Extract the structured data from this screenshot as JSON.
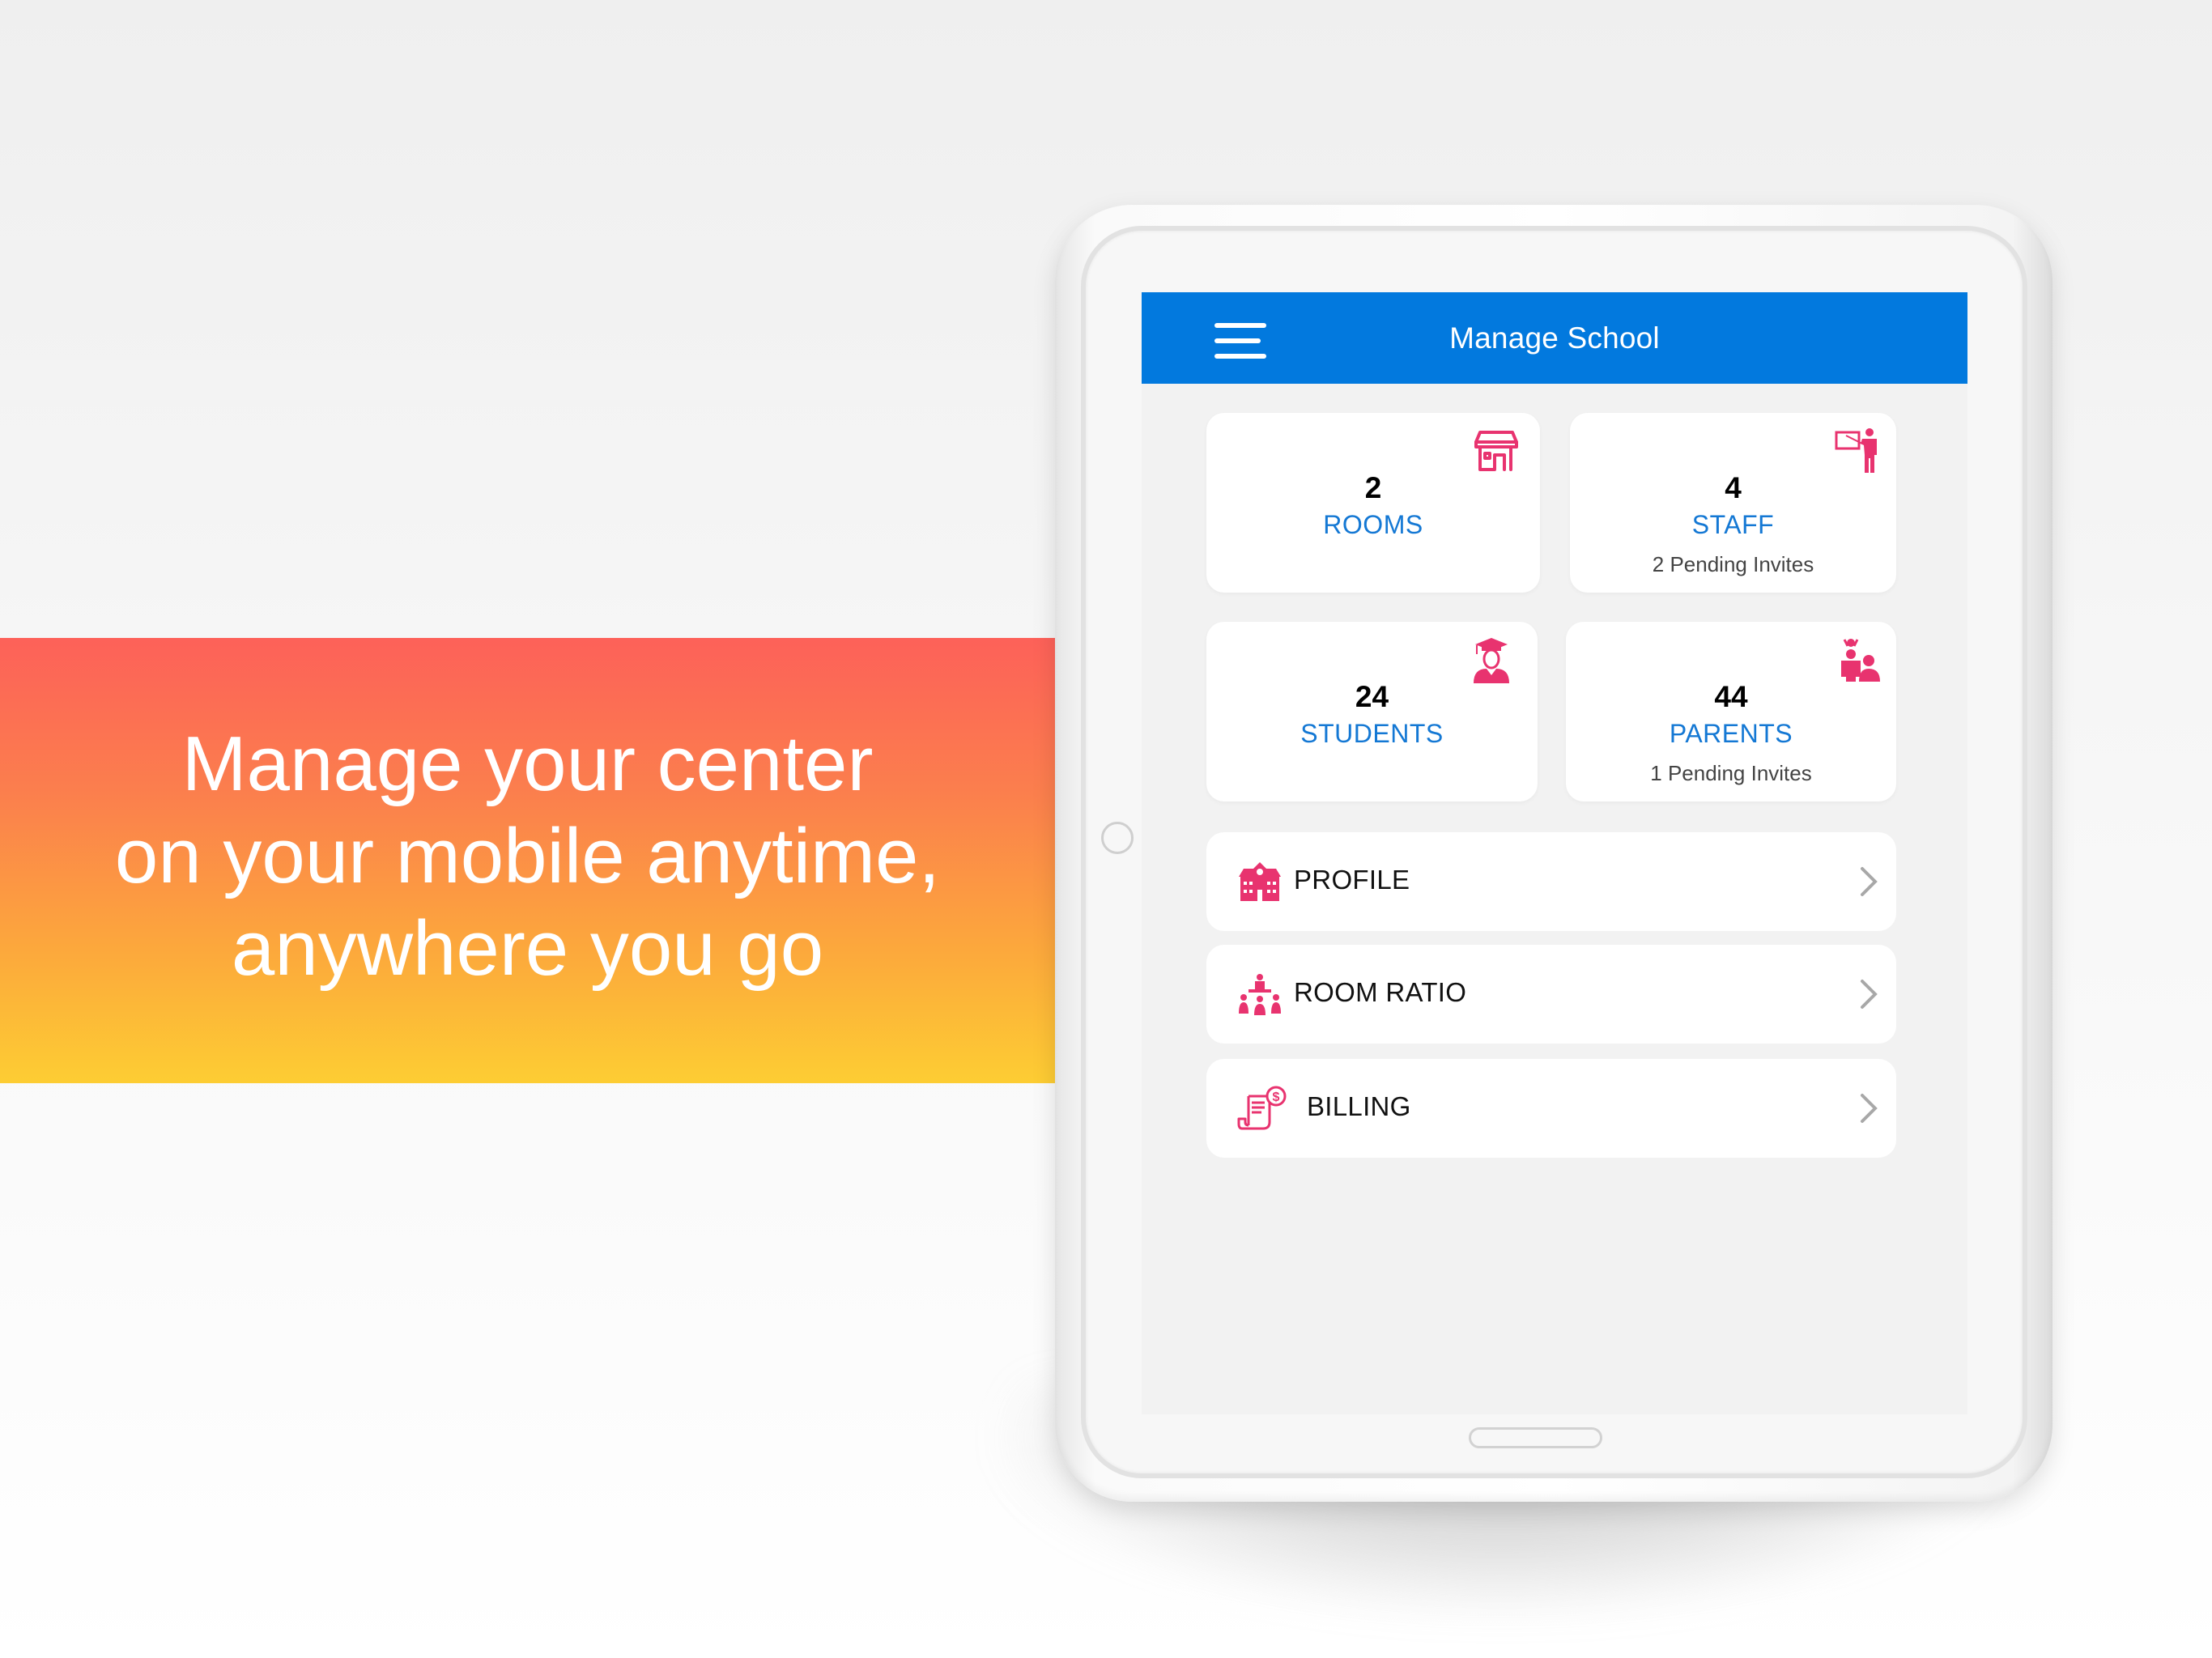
{
  "promo": {
    "headline_lines": [
      "Manage your center",
      "on your mobile anytime,",
      "anywhere you go"
    ],
    "gradient_colors": [
      "#fd6159",
      "#fdcd33"
    ]
  },
  "app": {
    "title": "Manage School",
    "menu_icon": "hamburger-menu-icon",
    "accent_color": "#0279de",
    "icon_color": "#e8336f"
  },
  "stats": [
    {
      "count": "2",
      "label": "ROOMS",
      "sub": "",
      "icon": "store-icon"
    },
    {
      "count": "4",
      "label": "STAFF",
      "sub": "2 Pending Invites",
      "icon": "teacher-icon"
    },
    {
      "count": "24",
      "label": "STUDENTS",
      "sub": "",
      "icon": "graduate-icon"
    },
    {
      "count": "44",
      "label": "PARENTS",
      "sub": "1 Pending Invites",
      "icon": "family-icon"
    }
  ],
  "menu": [
    {
      "label": "PROFILE",
      "icon": "school-building-icon"
    },
    {
      "label": "ROOM RATIO",
      "icon": "group-ratio-icon"
    },
    {
      "label": "BILLING",
      "icon": "invoice-dollar-icon"
    }
  ]
}
